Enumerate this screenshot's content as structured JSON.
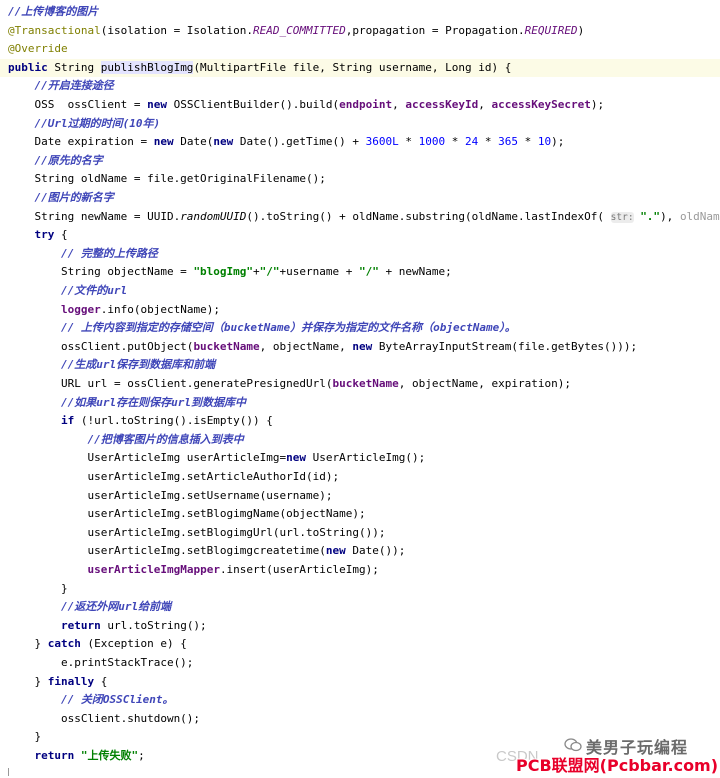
{
  "editor": {
    "lines": [
      [
        {
          "t": "//上传博客的图片",
          "c": "cmb"
        }
      ],
      [
        {
          "t": "@Transactional",
          "c": "ann"
        },
        {
          "t": "(isolation = Isolation.",
          "c": "plain"
        },
        {
          "t": "READ_COMMITTED",
          "c": "const"
        },
        {
          "t": ",propagation = Propagation.",
          "c": "plain"
        },
        {
          "t": "REQUIRED",
          "c": "const"
        },
        {
          "t": ")",
          "c": "plain"
        }
      ],
      [
        {
          "t": "@Override",
          "c": "ann"
        }
      ],
      [
        {
          "t": "public ",
          "c": "kw"
        },
        {
          "t": "String ",
          "c": "plain"
        },
        {
          "t": "publishBlogImg",
          "c": "sel"
        },
        {
          "t": "(MultipartFile file, String username, Long id) {",
          "c": "plain"
        }
      ],
      [
        {
          "t": "    //开启连接途径",
          "c": "cmb"
        }
      ],
      [
        {
          "t": "    OSS  ossClient = ",
          "c": "plain"
        },
        {
          "t": "new ",
          "c": "kw"
        },
        {
          "t": "OSSClientBuilder().build(",
          "c": "plain"
        },
        {
          "t": "endpoint",
          "c": "fld"
        },
        {
          "t": ", ",
          "c": "plain"
        },
        {
          "t": "accessKeyId",
          "c": "fld"
        },
        {
          "t": ", ",
          "c": "plain"
        },
        {
          "t": "accessKeySecret",
          "c": "fld"
        },
        {
          "t": ");",
          "c": "plain"
        }
      ],
      [
        {
          "t": "    //Url过期的时间(10年)",
          "c": "cmb"
        }
      ],
      [
        {
          "t": "    Date expiration = ",
          "c": "plain"
        },
        {
          "t": "new ",
          "c": "kw"
        },
        {
          "t": "Date(",
          "c": "plain"
        },
        {
          "t": "new ",
          "c": "kw"
        },
        {
          "t": "Date().getTime() + ",
          "c": "plain"
        },
        {
          "t": "3600L",
          "c": "num"
        },
        {
          "t": " * ",
          "c": "plain"
        },
        {
          "t": "1000",
          "c": "num"
        },
        {
          "t": " * ",
          "c": "plain"
        },
        {
          "t": "24",
          "c": "num"
        },
        {
          "t": " * ",
          "c": "plain"
        },
        {
          "t": "365",
          "c": "num"
        },
        {
          "t": " * ",
          "c": "plain"
        },
        {
          "t": "10",
          "c": "num"
        },
        {
          "t": ");",
          "c": "plain"
        }
      ],
      [
        {
          "t": "    //原先的名字",
          "c": "cmb"
        }
      ],
      [
        {
          "t": "    String oldName = file.getOriginalFilename();",
          "c": "plain"
        }
      ],
      [
        {
          "t": "    //图片的新名字",
          "c": "cmb"
        }
      ],
      [
        {
          "t": "    String newName = UUID.",
          "c": "plain"
        },
        {
          "t": "randomUUID",
          "c": "st"
        },
        {
          "t": "().toString() + oldName.substring(oldName.lastIndexOf( ",
          "c": "plain"
        },
        {
          "t": "str:",
          "c": "hint"
        },
        {
          "t": " ",
          "c": "plain"
        },
        {
          "t": "\".\"",
          "c": "str"
        },
        {
          "t": "), ",
          "c": "plain"
        },
        {
          "t": "oldName.length",
          "c": "gray"
        },
        {
          "t": "());",
          "c": "plain"
        }
      ],
      [
        {
          "t": "    try ",
          "c": "kw"
        },
        {
          "t": "{",
          "c": "plain"
        }
      ],
      [
        {
          "t": "        // 完整的上传路径",
          "c": "cmb"
        }
      ],
      [
        {
          "t": "        String objectName = ",
          "c": "plain"
        },
        {
          "t": "\"blogImg\"",
          "c": "str"
        },
        {
          "t": "+",
          "c": "plain"
        },
        {
          "t": "\"/\"",
          "c": "str"
        },
        {
          "t": "+username + ",
          "c": "plain"
        },
        {
          "t": "\"/\"",
          "c": "str"
        },
        {
          "t": " + newName;",
          "c": "plain"
        }
      ],
      [
        {
          "t": "        //文件的url",
          "c": "cmb"
        }
      ],
      [
        {
          "t": "        ",
          "c": "plain"
        },
        {
          "t": "logger",
          "c": "fld"
        },
        {
          "t": ".info(objectName);",
          "c": "plain"
        }
      ],
      [
        {
          "t": "        // 上传内容到指定的存储空间（bucketName）并保存为指定的文件名称（objectName）。",
          "c": "cmb"
        }
      ],
      [
        {
          "t": "        ossClient.putObject(",
          "c": "plain"
        },
        {
          "t": "bucketName",
          "c": "fld"
        },
        {
          "t": ", objectName, ",
          "c": "plain"
        },
        {
          "t": "new ",
          "c": "kw"
        },
        {
          "t": "ByteArrayInputStream(file.getBytes()));",
          "c": "plain"
        }
      ],
      [
        {
          "t": "        //生成url保存到数据库和前端",
          "c": "cmb"
        }
      ],
      [
        {
          "t": "        URL url = ossClient.generatePresignedUrl(",
          "c": "plain"
        },
        {
          "t": "bucketName",
          "c": "fld"
        },
        {
          "t": ", objectName, expiration);",
          "c": "plain"
        }
      ],
      [
        {
          "t": "        //如果url存在则保存url到数据库中",
          "c": "cmb"
        }
      ],
      [
        {
          "t": "        if ",
          "c": "kw"
        },
        {
          "t": "(!url.toString().isEmpty()) {",
          "c": "plain"
        }
      ],
      [
        {
          "t": "            //把博客图片的信息插入到表中",
          "c": "cmb"
        }
      ],
      [
        {
          "t": "            UserArticleImg userArticleImg=",
          "c": "plain"
        },
        {
          "t": "new ",
          "c": "kw"
        },
        {
          "t": "UserArticleImg();",
          "c": "plain"
        }
      ],
      [
        {
          "t": "            userArticleImg.setArticleAuthorId(id);",
          "c": "plain"
        }
      ],
      [
        {
          "t": "            userArticleImg.setUsername(username);",
          "c": "plain"
        }
      ],
      [
        {
          "t": "            userArticleImg.setBlogimgName(objectName);",
          "c": "plain"
        }
      ],
      [
        {
          "t": "            userArticleImg.setBlogimgUrl(url.toString());",
          "c": "plain"
        }
      ],
      [
        {
          "t": "            userArticleImg.setBlogimgcreatetime(",
          "c": "plain"
        },
        {
          "t": "new ",
          "c": "kw"
        },
        {
          "t": "Date());",
          "c": "plain"
        }
      ],
      [
        {
          "t": "            ",
          "c": "plain"
        },
        {
          "t": "userArticleImgMapper",
          "c": "fld"
        },
        {
          "t": ".insert(userArticleImg);",
          "c": "plain"
        }
      ],
      [
        {
          "t": "        }",
          "c": "plain"
        }
      ],
      [
        {
          "t": "        //返还外网url给前端",
          "c": "cmb"
        }
      ],
      [
        {
          "t": "        return ",
          "c": "kw"
        },
        {
          "t": "url.toString();",
          "c": "plain"
        }
      ],
      [
        {
          "t": "    } ",
          "c": "plain"
        },
        {
          "t": "catch ",
          "c": "kw"
        },
        {
          "t": "(Exception e) {",
          "c": "plain"
        }
      ],
      [
        {
          "t": "        e.printStackTrace();",
          "c": "plain"
        }
      ],
      [
        {
          "t": "    } ",
          "c": "plain"
        },
        {
          "t": "finally ",
          "c": "kw"
        },
        {
          "t": "{",
          "c": "plain"
        }
      ],
      [
        {
          "t": "        // 关闭OSSClient。",
          "c": "cmb"
        }
      ],
      [
        {
          "t": "        ossClient.shutdown();",
          "c": "plain"
        }
      ],
      [
        {
          "t": "    }",
          "c": "plain"
        }
      ],
      [
        {
          "t": "    return ",
          "c": "kw"
        },
        {
          "t": "\"上传失败\"",
          "c": "str"
        },
        {
          "t": ";",
          "c": "plain"
        }
      ]
    ]
  },
  "watermark": {
    "csdn": "CSDN",
    "account": "美男子玩编程",
    "site": "PCB联盟网(Pcbbar.com)",
    "icon": "wechat-icon"
  }
}
